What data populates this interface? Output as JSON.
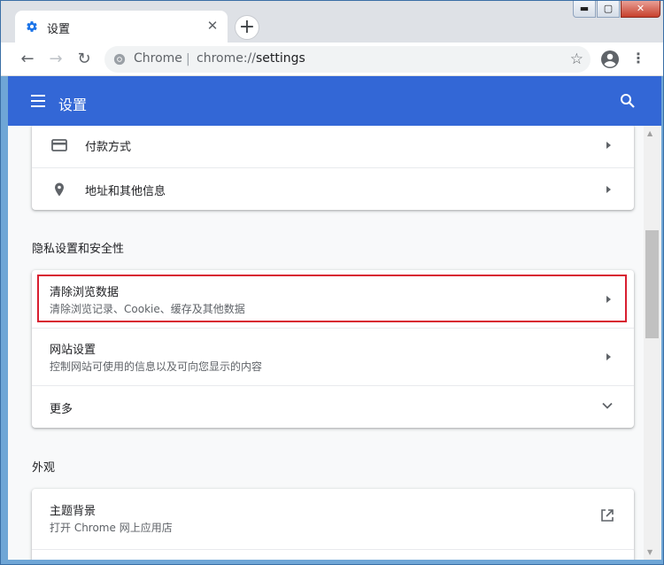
{
  "window": {
    "minimize_label": "▬",
    "maximize_label": "▢",
    "close_label": "✕"
  },
  "tab": {
    "title": "设置",
    "close_label": "✕",
    "new_tab_label": "+"
  },
  "toolbar": {
    "back_label": "←",
    "forward_label": "→",
    "reload_label": "↻",
    "origin_label": "Chrome",
    "separator": "|",
    "url_scheme": "chrome://",
    "url_path": "settings",
    "star_label": "☆",
    "menu_label": "⋮"
  },
  "appbar": {
    "title": "设置"
  },
  "autofill_card": {
    "rows": [
      {
        "label": "付款方式"
      },
      {
        "label": "地址和其他信息"
      }
    ]
  },
  "privacy": {
    "section_title": "隐私设置和安全性",
    "rows": [
      {
        "label": "清除浏览数据",
        "sublabel": "清除浏览记录、Cookie、缓存及其他数据"
      },
      {
        "label": "网站设置",
        "sublabel": "控制网站可使用的信息以及可向您显示的内容"
      },
      {
        "label": "更多"
      }
    ]
  },
  "appearance": {
    "section_title": "外观",
    "rows": [
      {
        "label": "主题背景",
        "sublabel": "打开 Chrome 网上应用店"
      }
    ]
  },
  "colors": {
    "appbar": "#3367d6",
    "highlight": "#d81e30",
    "tab_icon": "#1a73e8"
  }
}
